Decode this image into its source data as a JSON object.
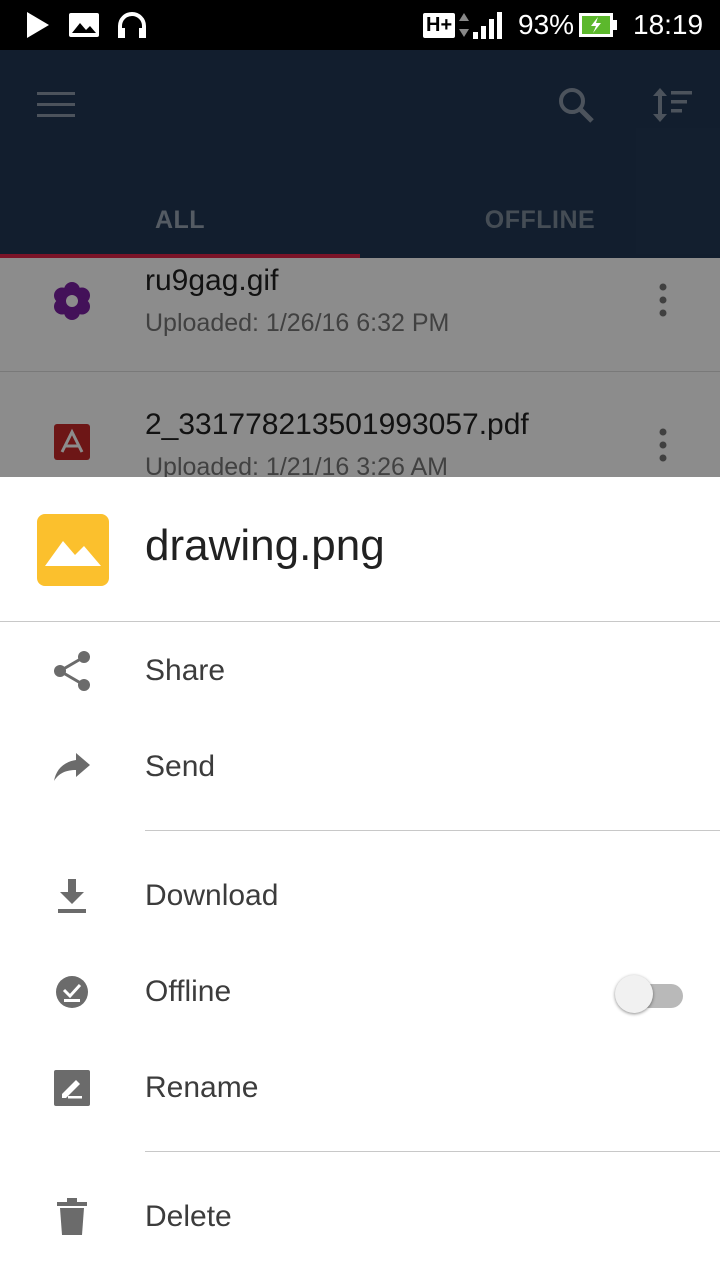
{
  "status_bar": {
    "network": "H+",
    "battery": "93%",
    "time": "18:19"
  },
  "app_bar": {
    "tabs": [
      {
        "label": "ALL",
        "selected": true
      },
      {
        "label": "OFFLINE",
        "selected": false
      }
    ],
    "accent_color": "#e0264a",
    "bar_color": "#223855"
  },
  "files": [
    {
      "name": "ru9gag.gif",
      "subtitle": "Uploaded: 1/26/16 6:32 PM",
      "icon": "flower-icon"
    },
    {
      "name": "2_331778213501993057.pdf",
      "subtitle": "Uploaded: 1/21/16 3:26 AM",
      "icon": "pdf-icon"
    }
  ],
  "sheet": {
    "file_name": "drawing.png",
    "thumb_icon": "image-icon",
    "thumb_color": "#fbc02d",
    "actions": [
      {
        "label": "Share",
        "icon": "share-icon"
      },
      {
        "label": "Send",
        "icon": "forward-icon"
      },
      {
        "label": "Download",
        "icon": "download-icon"
      },
      {
        "label": "Offline",
        "icon": "offline-check-icon",
        "toggle": false
      },
      {
        "label": "Rename",
        "icon": "rename-icon"
      },
      {
        "label": "Delete",
        "icon": "trash-icon"
      }
    ]
  }
}
